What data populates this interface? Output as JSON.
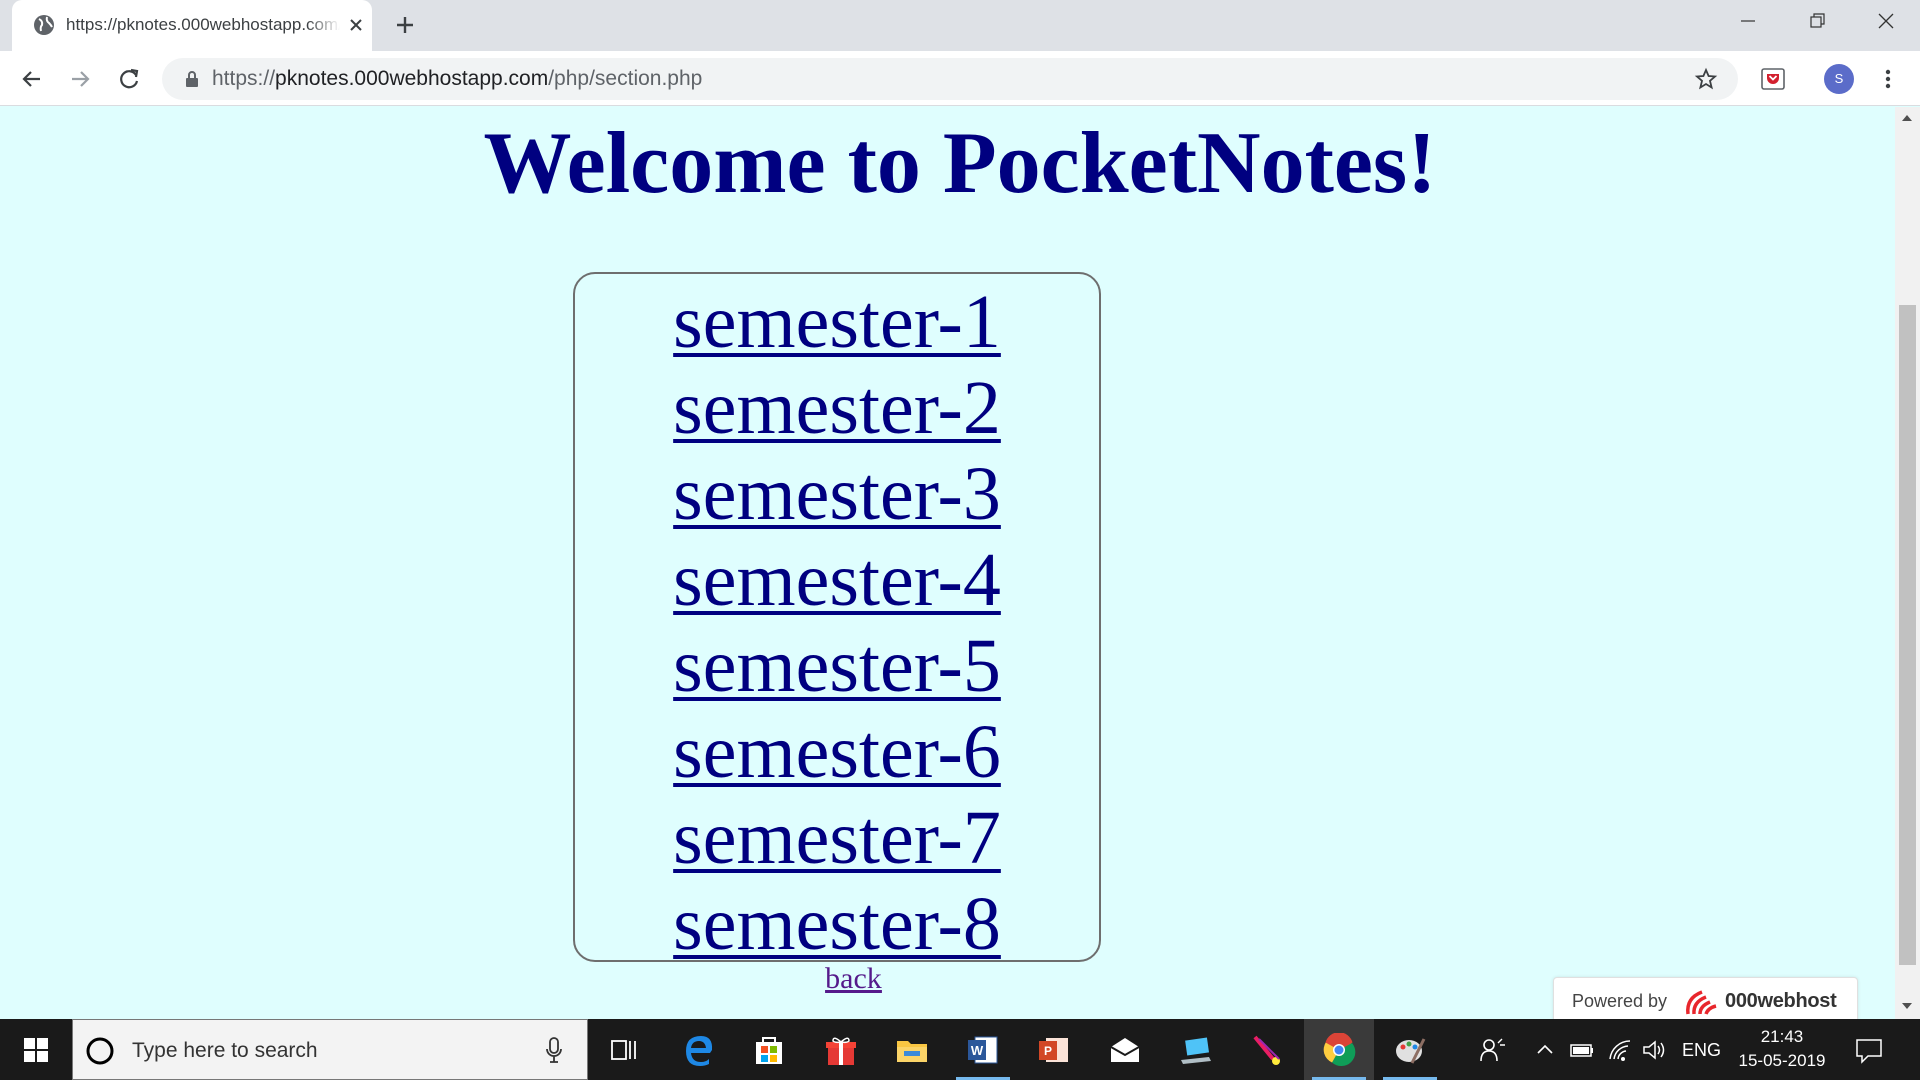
{
  "browser": {
    "tab_title": "https://pknotes.000webhostapp.com/php/section.php",
    "url_scheme": "https://",
    "url_host": "pknotes.000webhostapp.com",
    "url_path": "/php/section.php",
    "profile_initial": "S"
  },
  "page": {
    "title": "Welcome to PocketNotes!",
    "semesters": [
      "semester-1",
      "semester-2",
      "semester-3",
      "semester-4",
      "semester-5",
      "semester-6",
      "semester-7",
      "semester-8"
    ],
    "back_label": "back",
    "powered_by_label": "Powered by",
    "powered_by_brand": "000webhost"
  },
  "taskbar": {
    "search_placeholder": "Type here to search",
    "language": "ENG",
    "time": "21:43",
    "date": "15-05-2019"
  },
  "colors": {
    "page_background": "#dffefe",
    "link_color": "#000080",
    "visited_link_color": "#551a8b"
  }
}
